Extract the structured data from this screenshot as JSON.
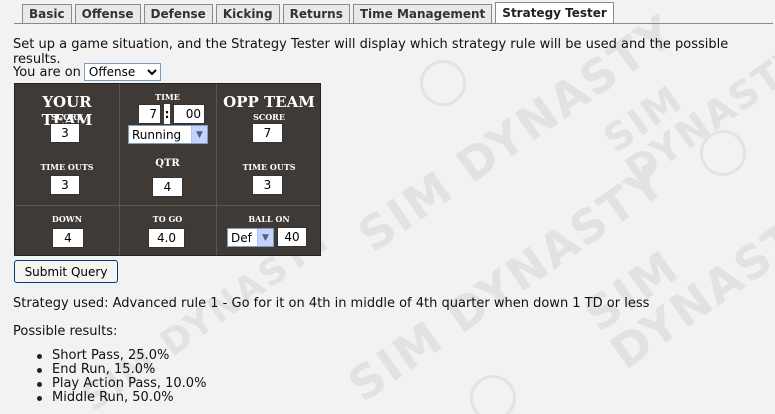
{
  "tabs": [
    {
      "label": "Basic",
      "active": false
    },
    {
      "label": "Offense",
      "active": false
    },
    {
      "label": "Defense",
      "active": false
    },
    {
      "label": "Kicking",
      "active": false
    },
    {
      "label": "Returns",
      "active": false
    },
    {
      "label": "Time Management",
      "active": false
    },
    {
      "label": "Strategy Tester",
      "active": true
    }
  ],
  "intro_text": "Set up a game situation, and the Strategy Tester will display which strategy rule will be used and the possible results.",
  "side": {
    "label": "You are on",
    "value": "Offense"
  },
  "board": {
    "your_team": "YOUR TEAM",
    "opp_team": "OPP TEAM",
    "score_label": "SCORE",
    "time_label": "TIME",
    "timeouts_label": "TIME OUTS",
    "qtr_label": "QTR",
    "down_label": "DOWN",
    "togo_label": "TO GO",
    "ballon_label": "BALL ON",
    "your_score": "3",
    "opp_score": "7",
    "time_min": "7",
    "time_sep": ":",
    "time_sec": "00",
    "clock_state": "Running",
    "your_timeouts": "3",
    "opp_timeouts": "3",
    "qtr": "4",
    "down": "4",
    "to_go": "4.0",
    "ball_side": "Def",
    "ball_on": "40"
  },
  "submit_label": "Submit Query",
  "strategy_used": "Strategy used: Advanced rule 1 - Go for it on 4th in middle of 4th quarter when down 1 TD or less",
  "possible_label": "Possible results:",
  "results": [
    "Short Pass, 25.0%",
    "End Run, 15.0%",
    "Play Action Pass, 10.0%",
    "Middle Run, 50.0%"
  ],
  "watermark": "SIM DYNASTY"
}
